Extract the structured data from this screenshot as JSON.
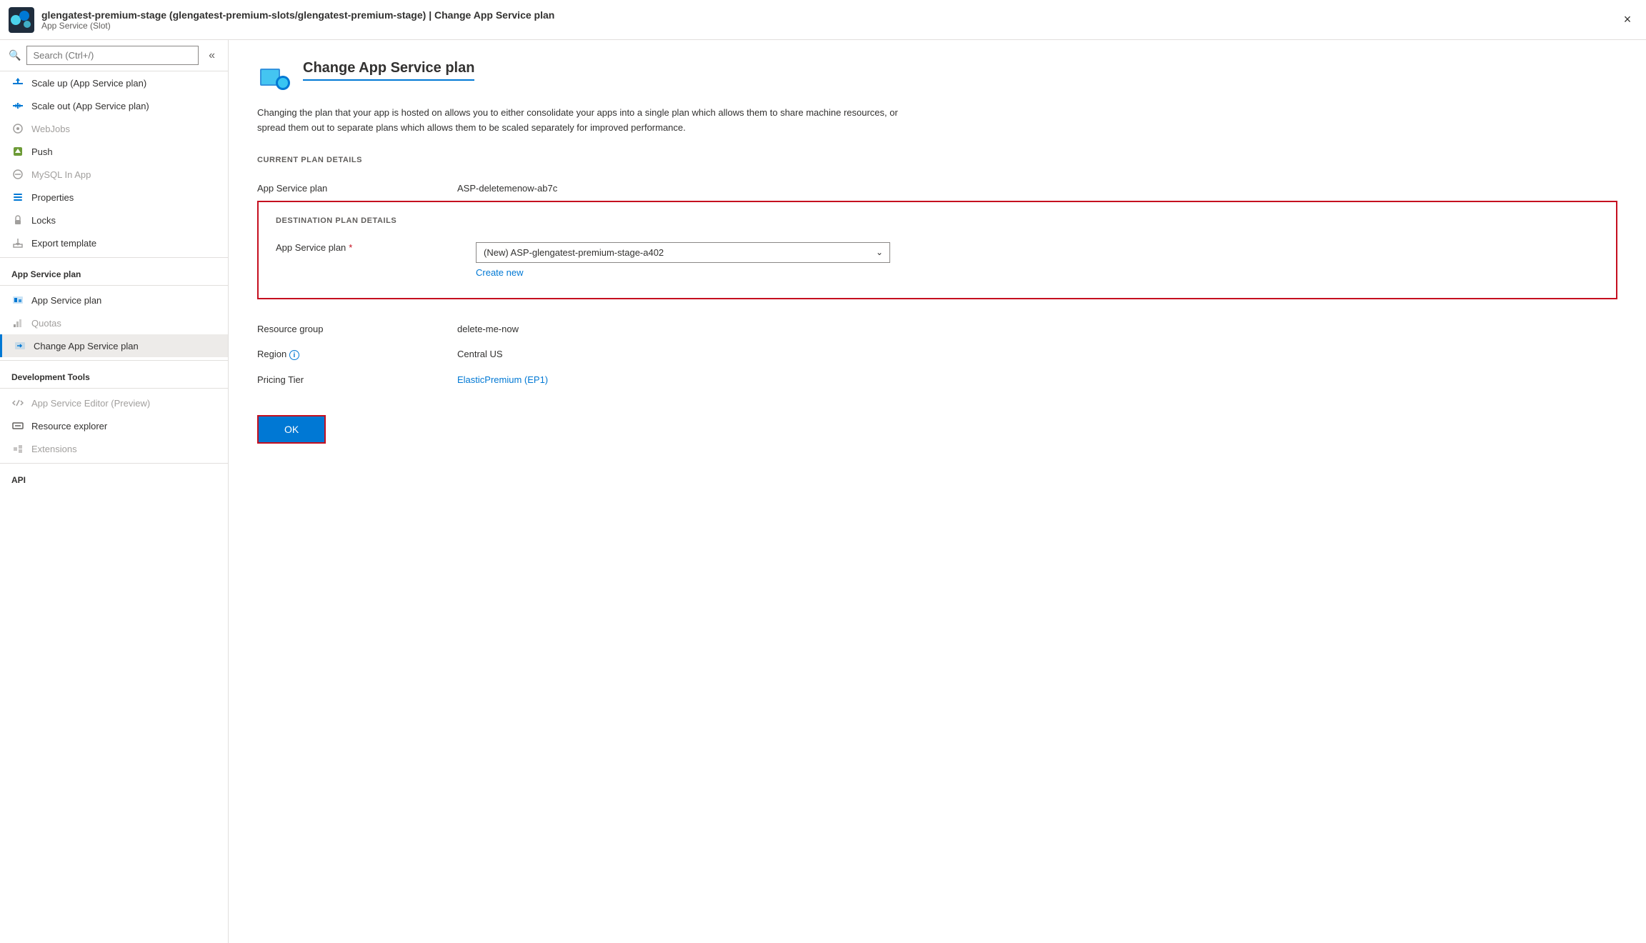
{
  "titleBar": {
    "title": "glengatest-premium-stage (glengatest-premium-slots/glengatest-premium-stage) | Change App Service plan",
    "subtitle": "App Service (Slot)",
    "closeLabel": "×"
  },
  "sidebar": {
    "searchPlaceholder": "Search (Ctrl+/)",
    "collapseIcon": "«",
    "items": [
      {
        "id": "scale-up",
        "label": "Scale up (App Service plan)",
        "icon": "scale-up",
        "disabled": false
      },
      {
        "id": "scale-out",
        "label": "Scale out (App Service plan)",
        "icon": "scale-out",
        "disabled": false
      },
      {
        "id": "webjobs",
        "label": "WebJobs",
        "icon": "webjobs",
        "disabled": true
      },
      {
        "id": "push",
        "label": "Push",
        "icon": "push",
        "disabled": false
      },
      {
        "id": "mysql",
        "label": "MySQL In App",
        "icon": "mysql",
        "disabled": true
      },
      {
        "id": "properties",
        "label": "Properties",
        "icon": "properties",
        "disabled": false
      },
      {
        "id": "locks",
        "label": "Locks",
        "icon": "locks",
        "disabled": false
      },
      {
        "id": "export",
        "label": "Export template",
        "icon": "export",
        "disabled": false
      }
    ],
    "appServicePlanSection": {
      "header": "App Service plan",
      "items": [
        {
          "id": "asp",
          "label": "App Service plan",
          "icon": "asp",
          "disabled": false
        },
        {
          "id": "quotas",
          "label": "Quotas",
          "icon": "quotas",
          "disabled": true
        },
        {
          "id": "change",
          "label": "Change App Service plan",
          "icon": "change",
          "disabled": false,
          "active": true
        }
      ]
    },
    "devToolsSection": {
      "header": "Development Tools",
      "items": [
        {
          "id": "editor",
          "label": "App Service Editor (Preview)",
          "icon": "editor",
          "disabled": true
        },
        {
          "id": "resource-explorer",
          "label": "Resource explorer",
          "icon": "resource-explorer",
          "disabled": false
        },
        {
          "id": "extensions",
          "label": "Extensions",
          "icon": "extensions",
          "disabled": true
        }
      ]
    },
    "apiSection": {
      "header": "API"
    }
  },
  "content": {
    "pageTitle": "Change App Service plan",
    "description": "Changing the plan that your app is hosted on allows you to either consolidate your apps into a single plan which allows them to share machine resources, or spread them out to separate plans which allows them to be scaled separately for improved performance.",
    "currentPlanSection": {
      "label": "CURRENT PLAN DETAILS",
      "fields": [
        {
          "label": "App Service plan",
          "value": "ASP-deletemenow-ab7c"
        }
      ]
    },
    "destinationSection": {
      "label": "DESTINATION PLAN DETAILS",
      "fields": [
        {
          "label": "App Service plan",
          "required": true,
          "type": "select",
          "selectedValue": "(New) ASP-glengatest-premium-stage-a402",
          "options": [
            "(New) ASP-glengatest-premium-stage-a402"
          ],
          "createNewLabel": "Create new"
        }
      ]
    },
    "infoSection": {
      "fields": [
        {
          "label": "Resource group",
          "value": "delete-me-now",
          "isLink": false
        },
        {
          "label": "Region",
          "value": "Central US",
          "hasInfo": true
        },
        {
          "label": "Pricing Tier",
          "value": "ElasticPremium (EP1)",
          "isLink": true
        }
      ]
    },
    "okButton": "OK"
  }
}
